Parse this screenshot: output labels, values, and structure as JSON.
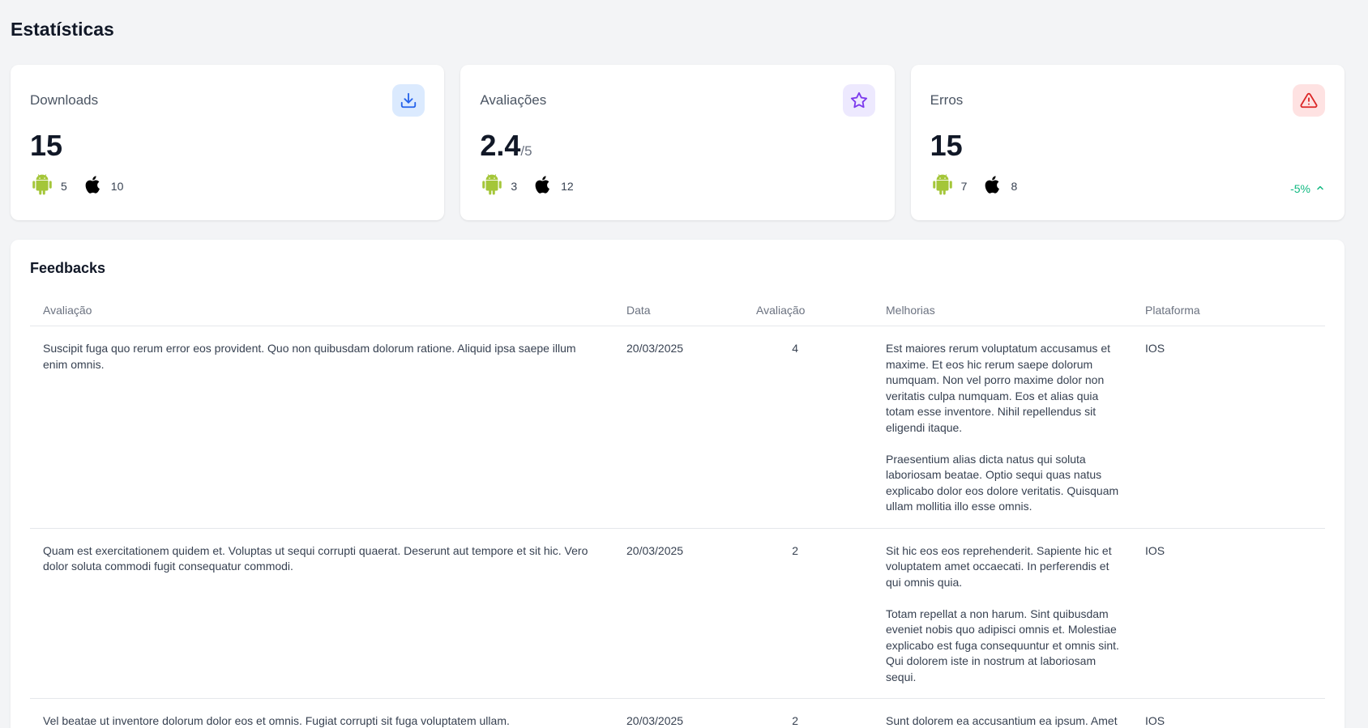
{
  "page": {
    "title": "Estatísticas"
  },
  "colors": {
    "android": "#a4c639",
    "apple": "#000000",
    "trend_positive": "#10b981"
  },
  "stats": [
    {
      "label": "Downloads",
      "value": "15",
      "suffix": "",
      "icon": "download-icon",
      "android": "5",
      "ios": "10",
      "trend": ""
    },
    {
      "label": "Avaliações",
      "value": "2.4",
      "suffix": "/5",
      "icon": "star-icon",
      "android": "3",
      "ios": "12",
      "trend": ""
    },
    {
      "label": "Erros",
      "value": "15",
      "suffix": "",
      "icon": "alert-triangle-icon",
      "android": "7",
      "ios": "8",
      "trend": "-5%"
    }
  ],
  "feedbacks": {
    "title": "Feedbacks",
    "columns": [
      "Avaliação",
      "Data",
      "Avaliação",
      "Melhorias",
      "Plataforma"
    ],
    "rows": [
      {
        "comment": "Suscipit fuga quo rerum error eos provident. Quo non quibusdam dolorum ratione. Aliquid ipsa saepe illum enim omnis.",
        "date": "20/03/2025",
        "rating": "4",
        "improvements": [
          "Est maiores rerum voluptatum accusamus et maxime. Et eos hic rerum saepe dolorum numquam. Non vel porro maxime dolor non veritatis culpa numquam. Eos et alias quia totam esse inventore. Nihil repellendus sit eligendi itaque.",
          "Praesentium alias dicta natus qui soluta laboriosam beatae. Optio sequi quas natus explicabo dolor eos dolore veritatis. Quisquam ullam mollitia illo esse omnis."
        ],
        "platform": "IOS"
      },
      {
        "comment": "Quam est exercitationem quidem et. Voluptas ut sequi corrupti quaerat. Deserunt aut tempore et sit hic. Vero dolor soluta commodi fugit consequatur commodi.",
        "date": "20/03/2025",
        "rating": "2",
        "improvements": [
          "Sit hic eos eos reprehenderit. Sapiente hic et voluptatem amet occaecati. In perferendis et qui omnis quia.",
          "Totam repellat a non harum. Sint quibusdam eveniet nobis quo adipisci omnis et. Molestiae explicabo est fuga consequuntur et omnis sint. Qui dolorem iste in nostrum at laboriosam sequi."
        ],
        "platform": "IOS"
      },
      {
        "comment": "Vel beatae ut inventore dolorum dolor eos et omnis. Fugiat corrupti sit fuga voluptatem ullam.",
        "date": "20/03/2025",
        "rating": "2",
        "improvements": [
          "Sunt dolorem ea accusantium ea ipsum. Amet"
        ],
        "platform": "IOS"
      }
    ]
  }
}
